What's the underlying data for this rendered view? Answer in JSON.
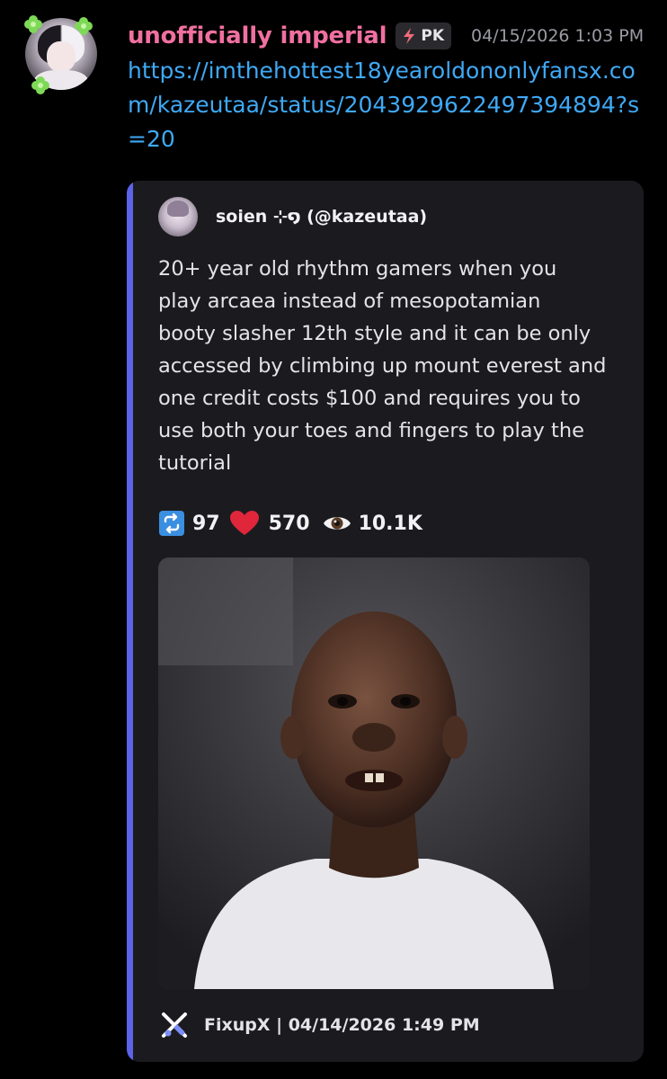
{
  "message": {
    "author": {
      "name": "unofficially imperial",
      "name_color": "#f0709f",
      "badge_icon": "lightning-icon",
      "badge_text": "PK"
    },
    "timestamp": "04/15/2026 1:03 PM",
    "link_text": "https://imthehottest18yearoldononlyfansx.com/kazeutaa/status/2043929622497394894?s=20",
    "link_color": "#3fa9f5"
  },
  "embed": {
    "accent_color": "#5b63e8",
    "author": "soien ⊹໑ (@kazeutaa)",
    "description": "20+ year old rhythm gamers when you\nplay arcaea instead of mesopotamian\nbooty slasher 12th style and it can be only\naccessed by climbing up mount everest and\none credit costs $100 and requires you to\nuse both your toes and fingers to play the\ntutorial",
    "stats": {
      "retweets": "97",
      "likes": "570",
      "views": "10.1K"
    },
    "footer": {
      "icon": "fixupx-icon",
      "text": "FixupX | 04/14/2026 1:49 PM"
    }
  }
}
